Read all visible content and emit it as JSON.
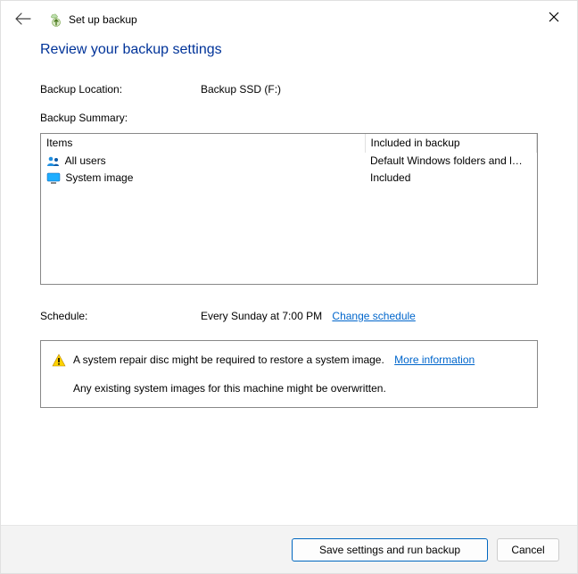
{
  "window": {
    "title": "Set up backup"
  },
  "heading": "Review your backup settings",
  "location": {
    "label": "Backup Location:",
    "value": "Backup SSD (F:)"
  },
  "summary": {
    "label": "Backup Summary:",
    "columns": {
      "items": "Items",
      "included": "Included in backup"
    },
    "rows": [
      {
        "icon": "users-icon",
        "item": "All users",
        "included": "Default Windows folders and l…"
      },
      {
        "icon": "monitor-icon",
        "item": "System image",
        "included": "Included"
      }
    ]
  },
  "schedule": {
    "label": "Schedule:",
    "value": "Every Sunday at 7:00 PM",
    "change_link": "Change schedule"
  },
  "warning": {
    "line1": "A system repair disc might be required to restore a system image.",
    "more_link": "More information",
    "line2": "Any existing system images for this machine might be overwritten."
  },
  "buttons": {
    "save": "Save settings and run backup",
    "cancel": "Cancel"
  }
}
